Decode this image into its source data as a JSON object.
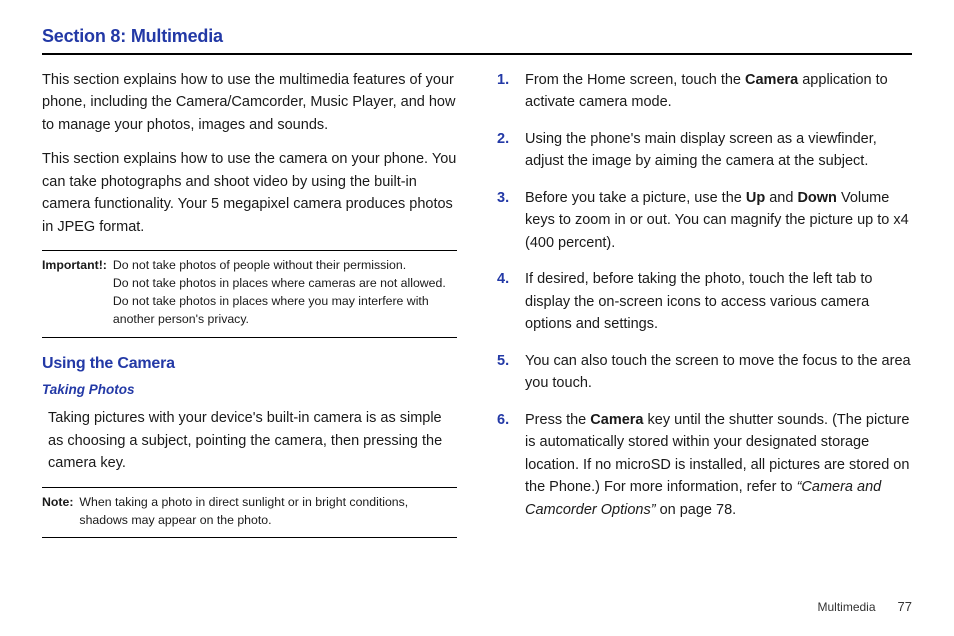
{
  "section_title": "Section 8: Multimedia",
  "left": {
    "intro1": "This section explains how to use the multimedia features of your phone, including the Camera/Camcorder, Music Player, and how to manage your photos, images and sounds.",
    "intro2": "This section explains how to use the camera on your phone. You can take photographs and shoot video by using the built-in camera functionality. Your 5 megapixel camera produces photos in JPEG format.",
    "important_label": "Important!:",
    "important_body": "Do not take photos of people without their permission.\nDo not take photos in places where cameras are not allowed.\nDo not take photos in places where you may interfere with another person's privacy.",
    "using_camera": "Using the Camera",
    "taking_photos": "Taking Photos",
    "taking_body": "Taking pictures with your device's built-in camera is as simple as choosing a subject, pointing the camera, then pressing the camera key.",
    "note_label": "Note:",
    "note_body": "When taking a photo in direct sunlight or in bright conditions, shadows may appear on the photo."
  },
  "steps": {
    "s1_a": "From the Home screen, touch the ",
    "s1_b": "Camera",
    "s1_c": " application to activate camera mode.",
    "s2": "Using the phone's main display screen as a viewfinder, adjust the image by aiming the camera at the subject.",
    "s3_a": "Before you take a picture, use the ",
    "s3_b": "Up",
    "s3_c": " and ",
    "s3_d": "Down",
    "s3_e": " Volume keys to zoom in or out. You can magnify the picture up to x4 (400 percent).",
    "s4": "If desired, before taking the photo, touch the left tab to display the on-screen icons to access various camera options and settings.",
    "s5": "You can also touch the screen to move the focus to the area you touch.",
    "s6_a": "Press the ",
    "s6_b": "Camera",
    "s6_c": " key until the shutter sounds. (The picture is automatically stored within your designated storage location. If no microSD is installed, all pictures are stored on the Phone.) For more information, refer to ",
    "s6_d": "“Camera and Camcorder Options”",
    "s6_e": "  on page 78."
  },
  "footer": {
    "chapter": "Multimedia",
    "page": "77"
  }
}
